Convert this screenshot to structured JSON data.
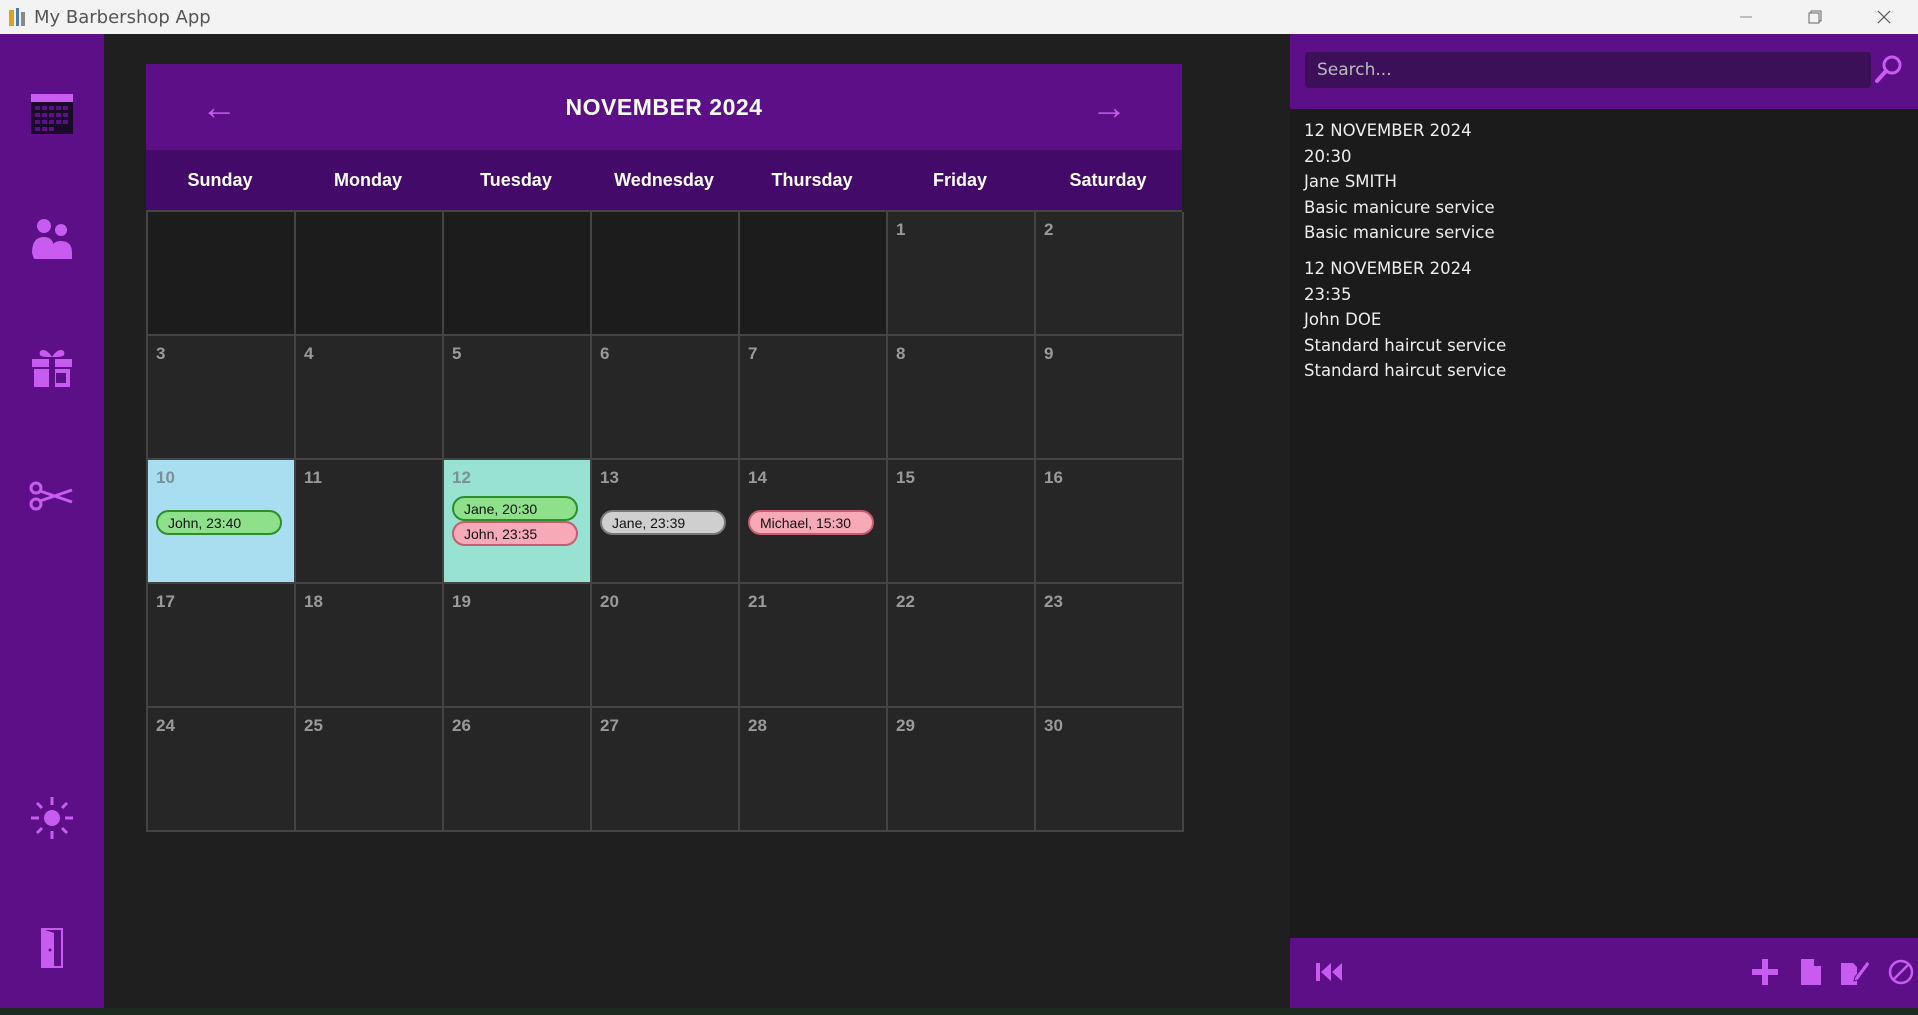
{
  "window": {
    "title": "My Barbershop App",
    "controls": [
      "minimize",
      "restore",
      "close"
    ]
  },
  "sidebar": {
    "items": [
      {
        "name": "calendar",
        "icon": "calendar-icon"
      },
      {
        "name": "clients",
        "icon": "users-icon"
      },
      {
        "name": "gifts",
        "icon": "gift-icon"
      },
      {
        "name": "services",
        "icon": "scissors-icon"
      },
      {
        "name": "theme",
        "icon": "sun-icon"
      },
      {
        "name": "exit",
        "icon": "door-icon"
      }
    ]
  },
  "calendar": {
    "title": "NOVEMBER 2024",
    "prev_arrow": "←",
    "next_arrow": "→",
    "weekdays": [
      "Sunday",
      "Monday",
      "Tuesday",
      "Wednesday",
      "Thursday",
      "Friday",
      "Saturday"
    ],
    "weeks": [
      [
        "",
        "",
        "",
        "",
        "",
        "1",
        "2"
      ],
      [
        "3",
        "4",
        "5",
        "6",
        "7",
        "8",
        "9"
      ],
      [
        "10",
        "11",
        "12",
        "13",
        "14",
        "15",
        "16"
      ],
      [
        "17",
        "18",
        "19",
        "20",
        "21",
        "22",
        "23"
      ],
      [
        "24",
        "25",
        "26",
        "27",
        "28",
        "29",
        "30"
      ]
    ],
    "appointments": {
      "10": [
        {
          "label": "John, 23:40",
          "color": "green"
        }
      ],
      "12": [
        {
          "label": "Jane, 20:30",
          "color": "green"
        },
        {
          "label": "John, 23:35",
          "color": "pink"
        }
      ],
      "13": [
        {
          "label": "Jane, 23:39",
          "color": "gray"
        }
      ],
      "14": [
        {
          "label": "Michael, 15:30",
          "color": "pink"
        }
      ]
    },
    "today": "10",
    "selected": "12"
  },
  "search": {
    "placeholder": "Search..."
  },
  "details": {
    "entries": [
      {
        "date": "12 NOVEMBER 2024",
        "time": "20:30",
        "client": "Jane SMITH",
        "service": "Basic manicure service",
        "description": "Basic manicure service"
      },
      {
        "date": "12 NOVEMBER 2024",
        "time": "23:35",
        "client": "John DOE",
        "service": "Standard haircut service",
        "description": "Standard haircut service"
      }
    ]
  },
  "bottom_toolbar": {
    "buttons": [
      "rewind-icon",
      "add-icon",
      "document-icon",
      "edit-icon",
      "cancel-icon"
    ]
  },
  "colors": {
    "accent": "#5c0f86",
    "accent_dark": "#440a6a",
    "icon": "#c85cf0",
    "today_bg": "#a9def0",
    "selected_bg": "#98e2d2",
    "appt_green": "#8ee08a",
    "appt_pink": "#f7a9b7",
    "appt_gray": "#cfcfcf"
  }
}
